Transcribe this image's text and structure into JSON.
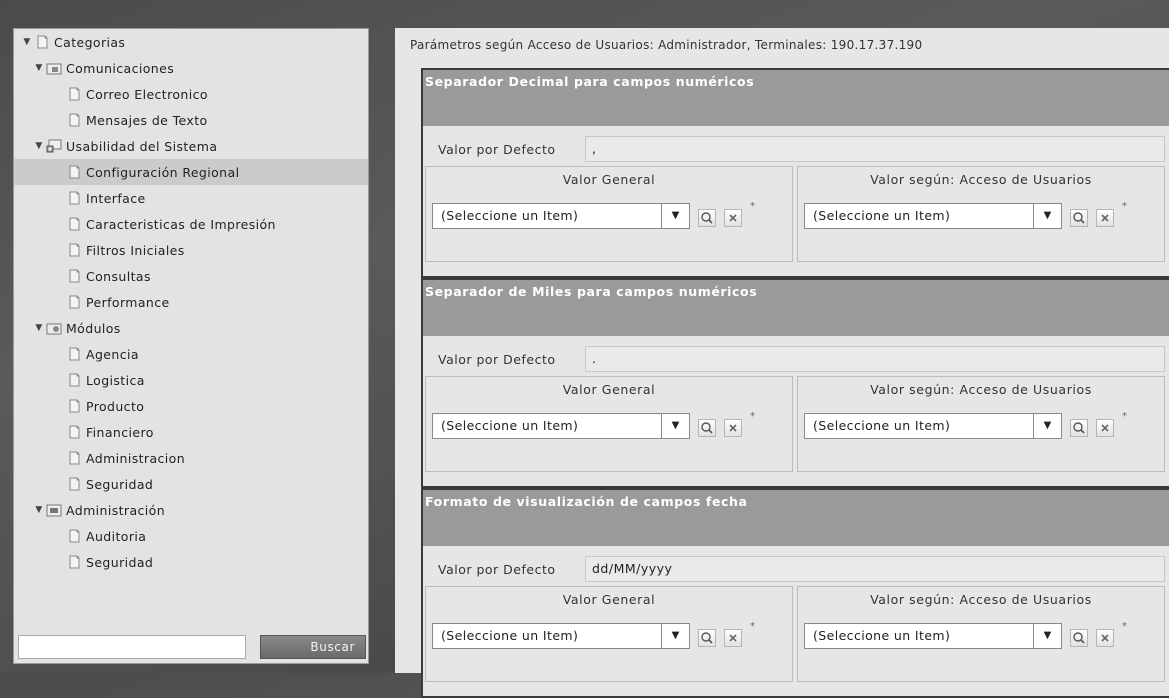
{
  "tree": {
    "items": [
      {
        "label": "Categorias",
        "expanded": true,
        "icon": "page-icon"
      },
      {
        "label": "Comunicaciones",
        "expanded": true,
        "icon": "folder-communications-icon"
      },
      {
        "label": "Correo Electronico",
        "icon": "page-icon"
      },
      {
        "label": "Mensajes de Texto",
        "icon": "page-icon"
      },
      {
        "label": "Usabilidad del Sistema",
        "expanded": true,
        "icon": "usability-icon"
      },
      {
        "label": "Configuración Regional",
        "icon": "page-icon",
        "selected": true
      },
      {
        "label": "Interface",
        "icon": "page-icon"
      },
      {
        "label": "Caracteristicas de Impresión",
        "icon": "page-icon"
      },
      {
        "label": "Filtros Iniciales",
        "icon": "page-icon"
      },
      {
        "label": "Consultas",
        "icon": "page-icon"
      },
      {
        "label": "Performance",
        "icon": "page-icon"
      },
      {
        "label": "Módulos",
        "expanded": true,
        "icon": "folder-modules-icon"
      },
      {
        "label": "Agencia",
        "icon": "page-icon"
      },
      {
        "label": "Logistica",
        "icon": "page-icon"
      },
      {
        "label": "Producto",
        "icon": "page-icon"
      },
      {
        "label": "Financiero",
        "icon": "page-icon"
      },
      {
        "label": "Administracion",
        "icon": "page-icon"
      },
      {
        "label": "Seguridad",
        "icon": "page-icon"
      },
      {
        "label": "Administración",
        "expanded": true,
        "icon": "folder-admin-icon"
      },
      {
        "label": "Auditoria",
        "icon": "page-icon"
      },
      {
        "label": "Seguridad",
        "icon": "page-icon"
      }
    ]
  },
  "search": {
    "input_value": "",
    "button_label": "Buscar"
  },
  "breadcrumb": "Parámetros según Acceso de Usuarios: Administrador, Terminales: 190.17.37.190",
  "sections": [
    {
      "title": "Separador Decimal para campos numéricos",
      "default_label": "Valor por Defecto",
      "default_value": ",",
      "general_title": "Valor General",
      "user_title": "Valor según: Acceso de Usuarios",
      "general_select": "(Seleccione un Item)",
      "user_select": "(Seleccione un Item)",
      "asterisk": "*"
    },
    {
      "title": "Separador de Miles para campos numéricos",
      "default_label": "Valor por Defecto",
      "default_value": ".",
      "general_title": "Valor General",
      "user_title": "Valor según: Acceso de Usuarios",
      "general_select": "(Seleccione un Item)",
      "user_select": "(Seleccione un Item)",
      "asterisk": "*"
    },
    {
      "title": "Formato de visualización de campos fecha",
      "default_label": "Valor por Defecto",
      "default_value": "dd/MM/yyyy",
      "general_title": "Valor General",
      "user_title": "Valor según: Acceso de Usuarios",
      "general_select": "(Seleccione un Item)",
      "user_select": "(Seleccione un Item)",
      "asterisk": "*"
    }
  ],
  "colors": {
    "section_header": "#9a9a9a",
    "selected_row": "#cbcbcb"
  }
}
